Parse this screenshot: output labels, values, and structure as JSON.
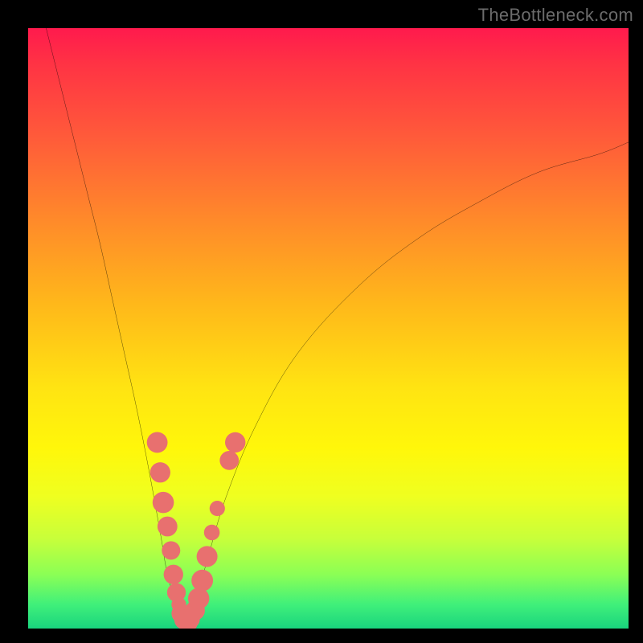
{
  "watermark": "TheBottleneck.com",
  "colors": {
    "background": "#000000",
    "gradient_top": "#ff1a4d",
    "gradient_bottom": "#19d47e",
    "curve": "#000000",
    "dot": "#e8706f"
  },
  "chart_data": {
    "type": "line",
    "title": "",
    "xlabel": "",
    "ylabel": "",
    "xlim": [
      0,
      100
    ],
    "ylim": [
      0,
      100
    ],
    "grid": false,
    "legend": false,
    "annotations": [
      "TheBottleneck.com"
    ],
    "series": [
      {
        "name": "bottleneck-curve-left",
        "x": [
          3,
          5,
          8,
          10,
          12,
          14,
          16,
          18,
          20,
          22,
          23,
          24,
          25,
          26
        ],
        "y": [
          100,
          92,
          80,
          72,
          64,
          55,
          46,
          37,
          27,
          16,
          10,
          6,
          2,
          0
        ]
      },
      {
        "name": "bottleneck-curve-right",
        "x": [
          26,
          28,
          30,
          33,
          38,
          45,
          55,
          65,
          75,
          85,
          95,
          100
        ],
        "y": [
          0,
          5,
          12,
          22,
          34,
          46,
          57,
          65,
          71,
          76,
          79,
          81
        ]
      }
    ],
    "scatter": {
      "name": "highlight-dots",
      "points": [
        {
          "x": 21.5,
          "y": 31
        },
        {
          "x": 22.0,
          "y": 26
        },
        {
          "x": 22.5,
          "y": 21
        },
        {
          "x": 23.2,
          "y": 17
        },
        {
          "x": 23.8,
          "y": 13
        },
        {
          "x": 24.2,
          "y": 9
        },
        {
          "x": 24.7,
          "y": 6
        },
        {
          "x": 25.1,
          "y": 4
        },
        {
          "x": 25.5,
          "y": 2.5
        },
        {
          "x": 26.0,
          "y": 1.5
        },
        {
          "x": 26.6,
          "y": 1
        },
        {
          "x": 27.2,
          "y": 1.5
        },
        {
          "x": 27.8,
          "y": 3
        },
        {
          "x": 28.4,
          "y": 5
        },
        {
          "x": 29.0,
          "y": 8
        },
        {
          "x": 29.8,
          "y": 12
        },
        {
          "x": 30.6,
          "y": 16
        },
        {
          "x": 31.5,
          "y": 20
        },
        {
          "x": 33.5,
          "y": 28
        },
        {
          "x": 34.5,
          "y": 31
        }
      ],
      "r_base": 1.2,
      "r_jitter": 0.6
    }
  }
}
